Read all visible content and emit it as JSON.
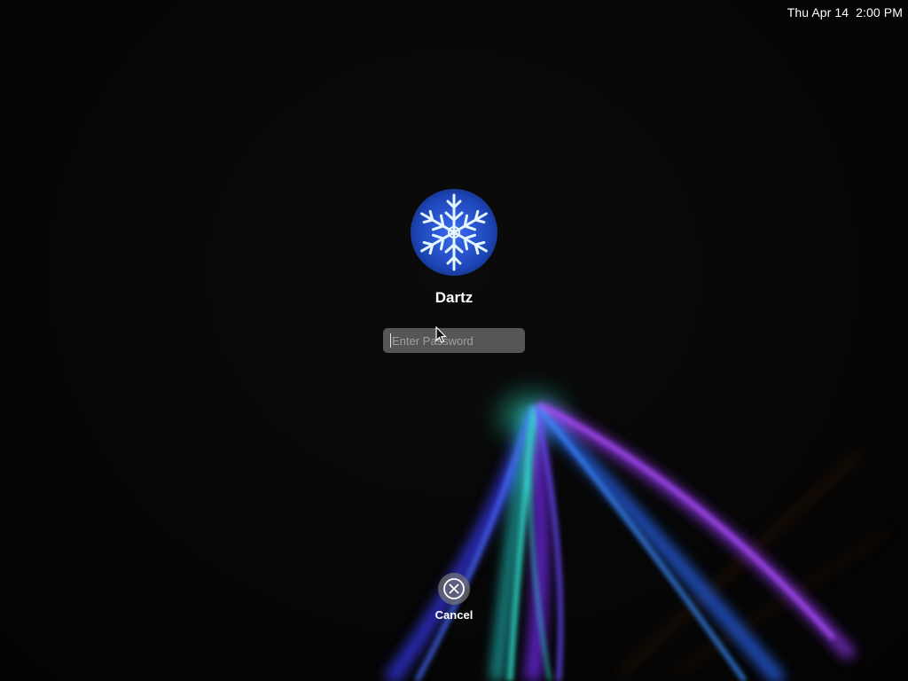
{
  "menubar": {
    "clock": "Thu Apr 14  2:00 PM"
  },
  "login": {
    "user_name": "Dartz",
    "password_placeholder": "Enter Password",
    "avatar_icon": "snowflake-avatar"
  },
  "actions": {
    "cancel_label": "Cancel",
    "cancel_icon": "x-circle-icon"
  },
  "colors": {
    "background": "#050505",
    "avatar_blue": "#1f4fc4",
    "accent_teal": "#2be0c0",
    "accent_purple": "#8a3cff"
  }
}
